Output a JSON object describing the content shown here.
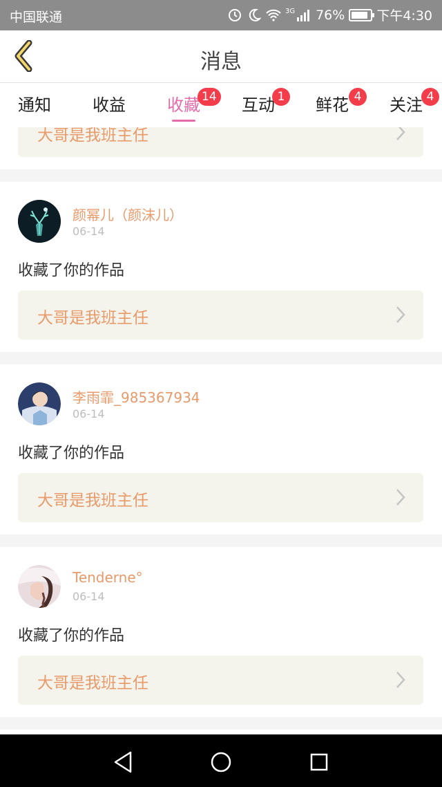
{
  "status_bar": {
    "carrier": "中国联通",
    "network": "3G",
    "battery": "76%",
    "time": "下午4:30"
  },
  "header": {
    "title": "消息"
  },
  "tabs": [
    {
      "label": "通知",
      "badge": ""
    },
    {
      "label": "收益",
      "badge": ""
    },
    {
      "label": "收藏",
      "badge": "14",
      "active": true
    },
    {
      "label": "互动",
      "badge": "1"
    },
    {
      "label": "鲜花",
      "badge": "4"
    },
    {
      "label": "关注",
      "badge": "4"
    }
  ],
  "feed": {
    "partial_item": {
      "work_title": "大哥是我班主任"
    },
    "items": [
      {
        "username": "颜幂儿（颜沫儿）",
        "date": "06-14",
        "action": "收藏了你的作品",
        "work_title": "大哥是我班主任",
        "avatar": "deer-avatar"
      },
      {
        "username": "李雨霏_985367934",
        "date": "06-14",
        "action": "收藏了你的作品",
        "work_title": "大哥是我班主任",
        "avatar": "person-avatar"
      },
      {
        "username": "Tenderne°",
        "date": "06-14",
        "action": "收藏了你的作品",
        "work_title": "大哥是我班主任",
        "avatar": "girl-avatar"
      }
    ]
  },
  "colors": {
    "accent": "#e56bab",
    "badge": "#f33d4b",
    "username": "#e89a6a",
    "work_bg": "#f5f4ec"
  },
  "icons": {
    "back": "back-chevron-icon",
    "chevron": "chevron-right-icon",
    "nav": [
      "nav-back-icon",
      "nav-home-icon",
      "nav-recents-icon"
    ]
  }
}
